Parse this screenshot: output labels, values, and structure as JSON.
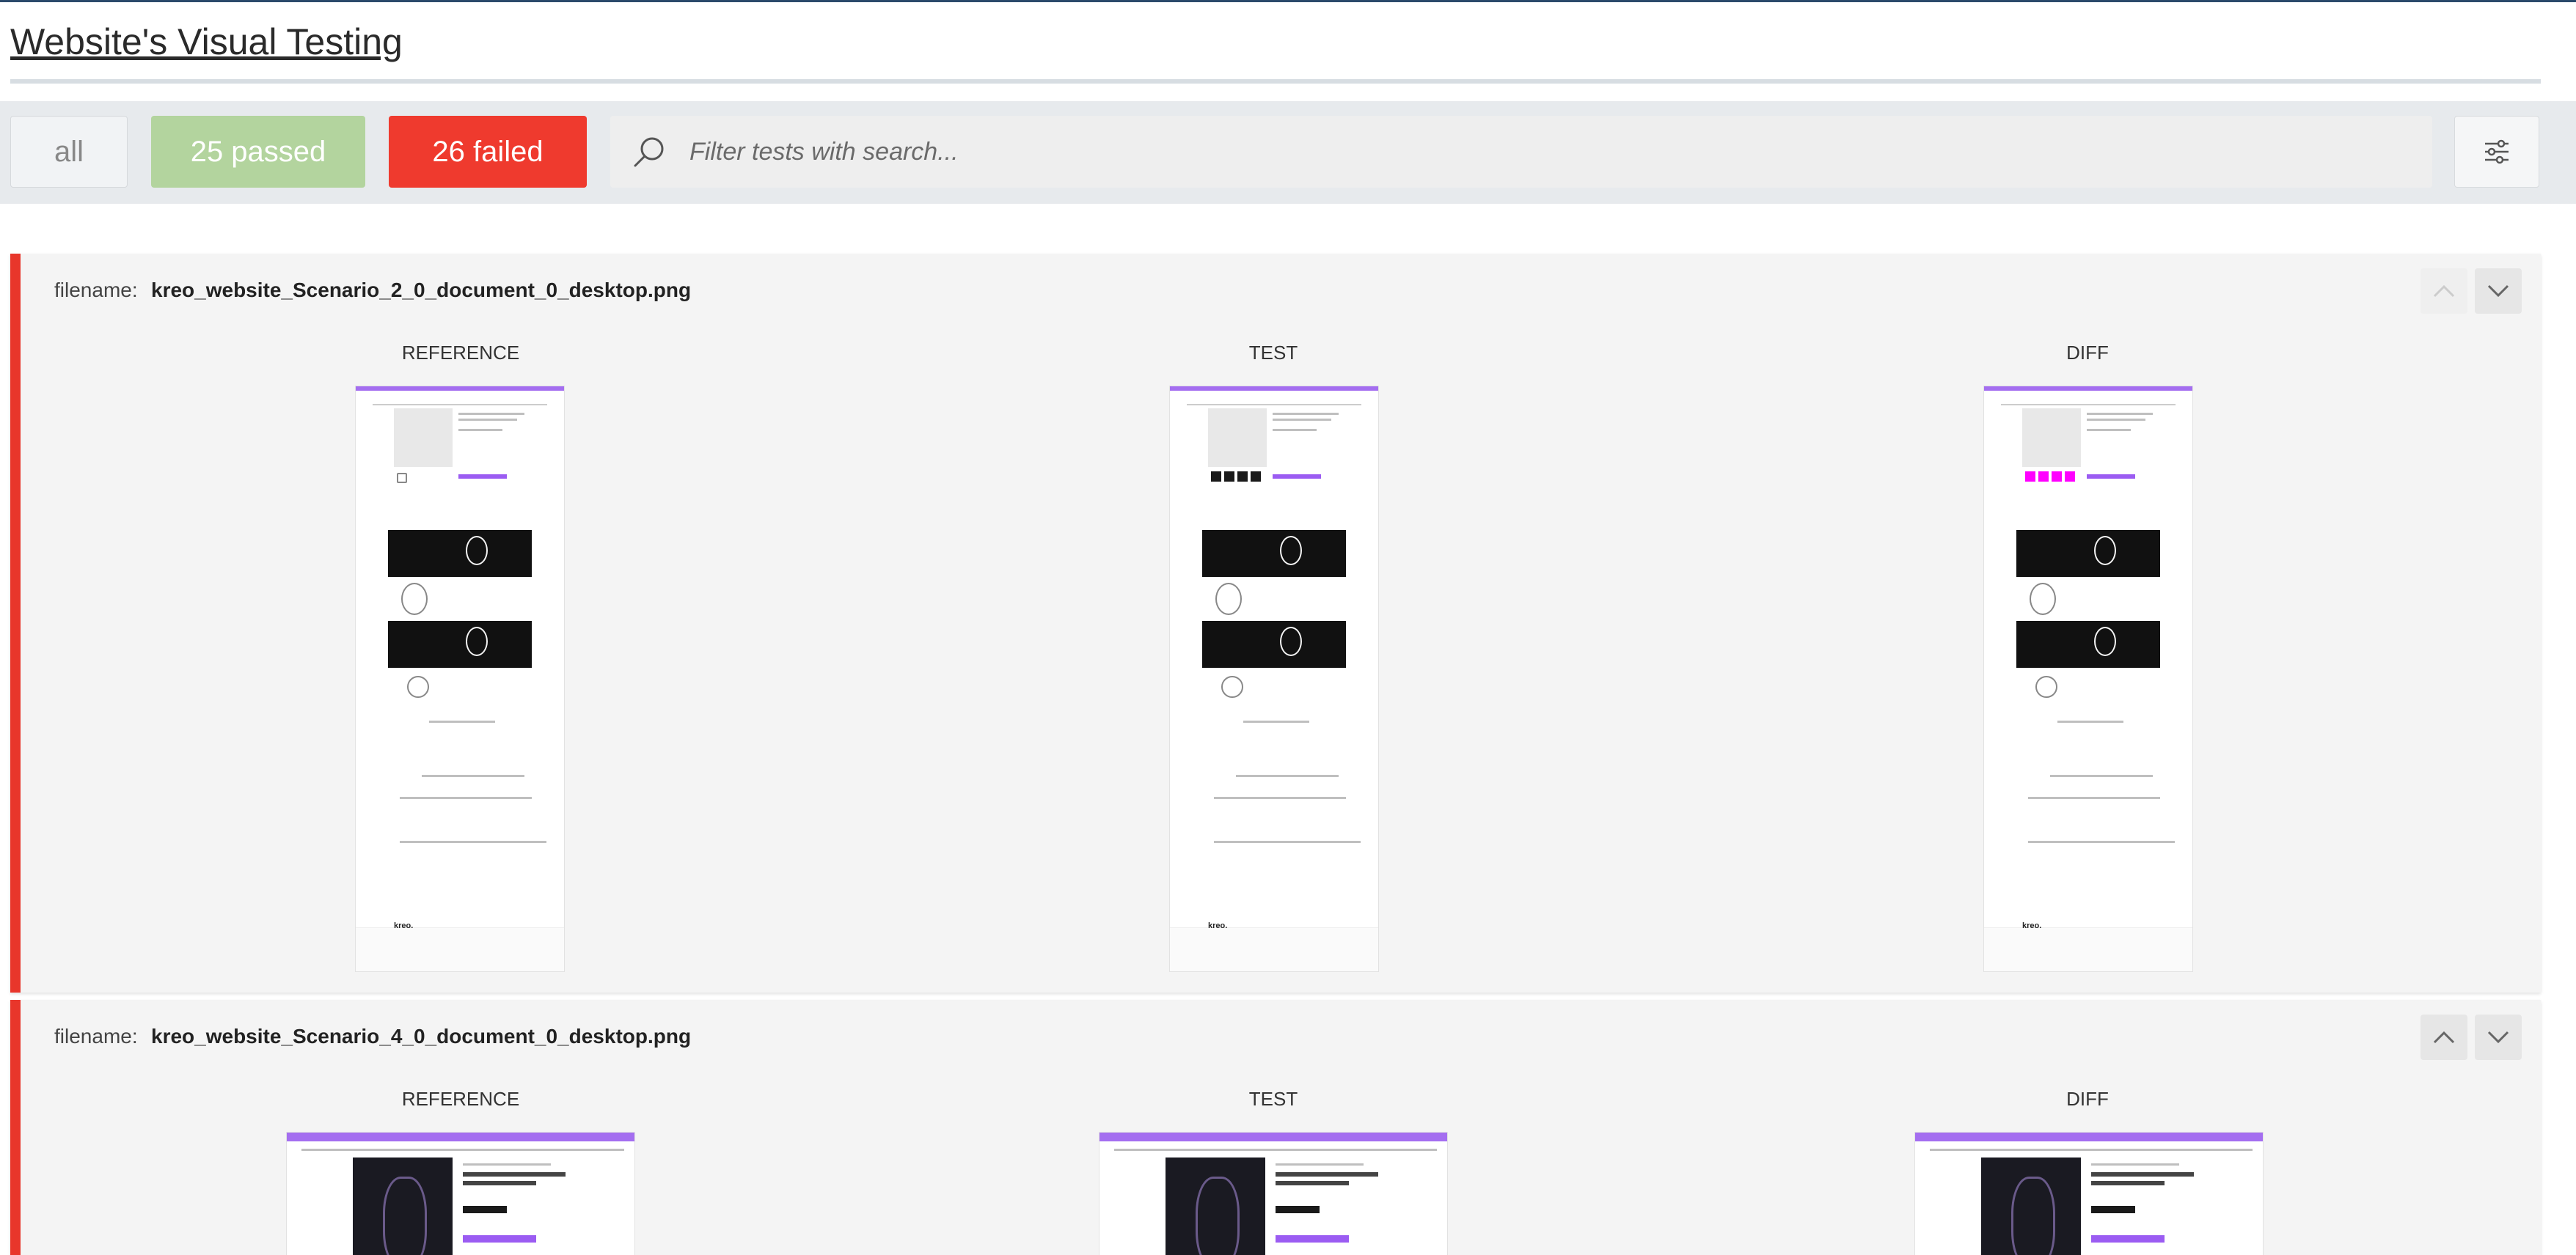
{
  "page": {
    "title": "Website's Visual Testing"
  },
  "toolbar": {
    "all_label": "all",
    "passed_label": "25 passed",
    "failed_label": "26 failed",
    "search_placeholder": "Filter tests with search...",
    "colors": {
      "passed": "#b3d49e",
      "failed": "#ef3a2e",
      "all": "#f1f3f5"
    }
  },
  "tests": [
    {
      "filename_label": "filename:",
      "filename": "kreo_website_Scenario_2_0_document_0_desktop.png",
      "status": "failed",
      "columns": [
        "REFERENCE",
        "TEST",
        "DIFF"
      ]
    },
    {
      "filename_label": "filename:",
      "filename": "kreo_website_Scenario_4_0_document_0_desktop.png",
      "status": "failed",
      "columns": [
        "REFERENCE",
        "TEST",
        "DIFF"
      ]
    }
  ],
  "icons": {
    "search": "search-icon",
    "settings": "sliders-icon",
    "up": "chevron-up-icon",
    "down": "chevron-down-icon"
  }
}
